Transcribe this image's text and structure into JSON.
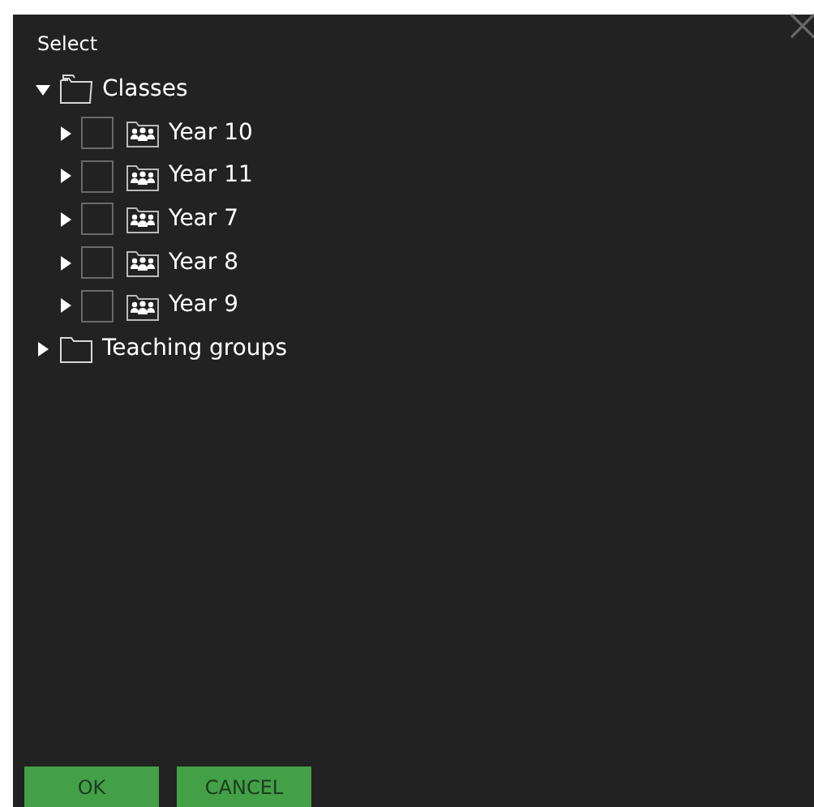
{
  "dialog": {
    "title": "Select"
  },
  "tree": [
    {
      "label": "Classes",
      "kind": "folder",
      "expanded": true,
      "children": [
        {
          "label": "Year 10",
          "kind": "group",
          "expanded": false,
          "checked": false
        },
        {
          "label": "Year 11",
          "kind": "group",
          "expanded": false,
          "checked": false
        },
        {
          "label": "Year 7",
          "kind": "group",
          "expanded": false,
          "checked": false
        },
        {
          "label": "Year 8",
          "kind": "group",
          "expanded": false,
          "checked": false
        },
        {
          "label": "Year 9",
          "kind": "group",
          "expanded": false,
          "checked": false
        }
      ]
    },
    {
      "label": "Teaching groups",
      "kind": "folder",
      "expanded": false
    }
  ],
  "buttons": [
    "OK",
    "CANCEL"
  ]
}
